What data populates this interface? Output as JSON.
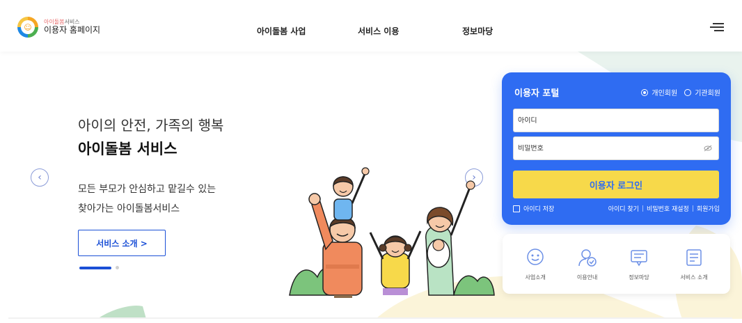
{
  "header": {
    "logo_sub_accent": "아이돌봄",
    "logo_sub": "서비스",
    "logo_main": "이용자 홈페이지",
    "nav": [
      "아이돌봄 사업",
      "서비스 이용",
      "정보마당"
    ]
  },
  "hero": {
    "title_line1": "아이의 안전, 가족의 행복",
    "title_line2": "아이돌봄 서비스",
    "desc_line1": "모든 부모가 안심하고 맡길수 있는",
    "desc_line2": "찾아가는 아이돌봄서비스",
    "button": "서비스 소개 >",
    "prev_icon": "chevron-left-icon",
    "next_icon": "chevron-right-icon"
  },
  "portal": {
    "title": "이용자 포털",
    "radio_personal": "개인회원",
    "radio_org": "기관회원",
    "selected": "개인회원",
    "id_placeholder": "아이디",
    "pw_placeholder": "비밀번호",
    "login_button": "이용자 로그인",
    "save_id": "아이디 저장",
    "find_id": "아이디 찾기",
    "reset_pw": "비밀번호 재설정",
    "signup": "회원가입"
  },
  "quick_menu": [
    {
      "label": "사업소개",
      "icon": "business-intro-icon"
    },
    {
      "label": "이용안내",
      "icon": "user-guide-icon"
    },
    {
      "label": "정보마당",
      "icon": "info-board-icon"
    },
    {
      "label": "서비스 소개",
      "icon": "service-intro-icon"
    }
  ],
  "colors": {
    "primary": "#2f6cf2",
    "button_yellow": "#f7d94a",
    "accent_blue": "#1a4fd6"
  }
}
